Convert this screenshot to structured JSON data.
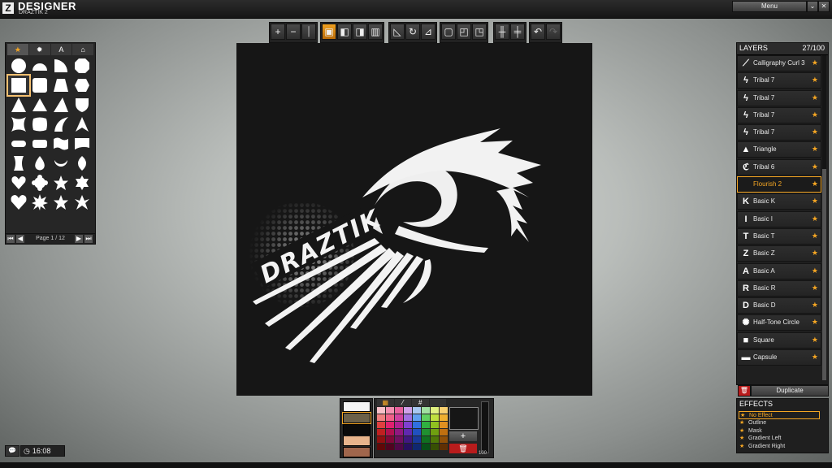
{
  "app": {
    "logo": "Z",
    "title": "DESIGNER",
    "subtitle": "DRAZTIK 2",
    "menu_label": "Menu"
  },
  "toolbar": {
    "groups": [
      [
        "plus-icon",
        "minus-icon",
        "bar-icon"
      ],
      [
        "fill-icon",
        "layer-front-icon",
        "layer-back-icon",
        "layer-split-icon"
      ],
      [
        "skew-icon",
        "rotate-icon",
        "perspective-icon"
      ],
      [
        "align-center-icon",
        "align-top-icon",
        "align-right-icon"
      ],
      [
        "flip-horizontal-icon",
        "flip-vertical-icon"
      ],
      [
        "undo-icon",
        "redo-icon"
      ]
    ]
  },
  "shapes_panel": {
    "tabs": [
      "★",
      "✹",
      "A",
      "⌂"
    ],
    "page_label": "Page 1 / 12"
  },
  "canvas": {
    "logo_text": "DRAZTIK"
  },
  "layers": {
    "title": "LAYERS",
    "count": "27/100",
    "items": [
      {
        "label": "Calligraphy Curl 3",
        "icon": "curl-icon",
        "glyph": "⟋"
      },
      {
        "label": "Tribal 7",
        "icon": "tribal-icon",
        "glyph": "ϟ"
      },
      {
        "label": "Tribal 7",
        "icon": "tribal-icon",
        "glyph": "ϟ"
      },
      {
        "label": "Tribal 7",
        "icon": "tribal-icon",
        "glyph": "ϟ"
      },
      {
        "label": "Tribal 7",
        "icon": "tribal-icon",
        "glyph": "ϟ"
      },
      {
        "label": "Triangle",
        "icon": "triangle-icon",
        "glyph": "▲"
      },
      {
        "label": "Tribal 6",
        "icon": "tribal-icon",
        "glyph": "ℭ"
      },
      {
        "label": "Flourish 2",
        "icon": "flourish-icon",
        "glyph": ""
      },
      {
        "label": "Basic K",
        "icon": "letter-k-icon",
        "glyph": "K"
      },
      {
        "label": "Basic I",
        "icon": "letter-i-icon",
        "glyph": "I"
      },
      {
        "label": "Basic T",
        "icon": "letter-t-icon",
        "glyph": "T"
      },
      {
        "label": "Basic Z",
        "icon": "letter-z-icon",
        "glyph": "Z"
      },
      {
        "label": "Basic A",
        "icon": "letter-a-icon",
        "glyph": "A"
      },
      {
        "label": "Basic R",
        "icon": "letter-r-icon",
        "glyph": "R"
      },
      {
        "label": "Basic D",
        "icon": "letter-d-icon",
        "glyph": "D"
      },
      {
        "label": "Half-Tone Circle",
        "icon": "halftone-icon",
        "glyph": "✺"
      },
      {
        "label": "Square",
        "icon": "square-icon",
        "glyph": "■"
      },
      {
        "label": "Capsule",
        "icon": "capsule-icon",
        "glyph": "▬"
      }
    ],
    "duplicate_label": "Duplicate"
  },
  "effects": {
    "title": "EFFECTS",
    "items": [
      "No Effect",
      "Outline",
      "Mask",
      "Gradient Left",
      "Gradient Right"
    ]
  },
  "colors": {
    "accent": "#f5a623",
    "swatches": [
      "#f4f4f4",
      "#6b6048",
      "#0a0a0a",
      "#e8b48c",
      "#a0664c"
    ],
    "palette_tabs": [
      "▦",
      "⁄",
      "#",
      ""
    ],
    "palette": [
      "#f7c0c8",
      "#f28fb0",
      "#e8609c",
      "#d0a0e8",
      "#a8c8f0",
      "#a0e0a0",
      "#e0f080",
      "#f8d070",
      "#f08080",
      "#f06088",
      "#d040a0",
      "#a070e0",
      "#60a0f0",
      "#60d060",
      "#c0e040",
      "#f0b030",
      "#e04040",
      "#e02070",
      "#b02090",
      "#8040d0",
      "#3070e0",
      "#30b040",
      "#90c020",
      "#e09020",
      "#c02020",
      "#b01050",
      "#901880",
      "#6028b0",
      "#2050c0",
      "#209030",
      "#70a010",
      "#c07010",
      "#901010",
      "#800838",
      "#701060",
      "#401880",
      "#183898",
      "#107020",
      "#507808",
      "#905008",
      "#600808",
      "#500420",
      "#500848",
      "#281060",
      "#102870",
      "#085018",
      "#385004",
      "#603004"
    ],
    "opacity_label": "100"
  },
  "status": {
    "time": "16:08"
  }
}
